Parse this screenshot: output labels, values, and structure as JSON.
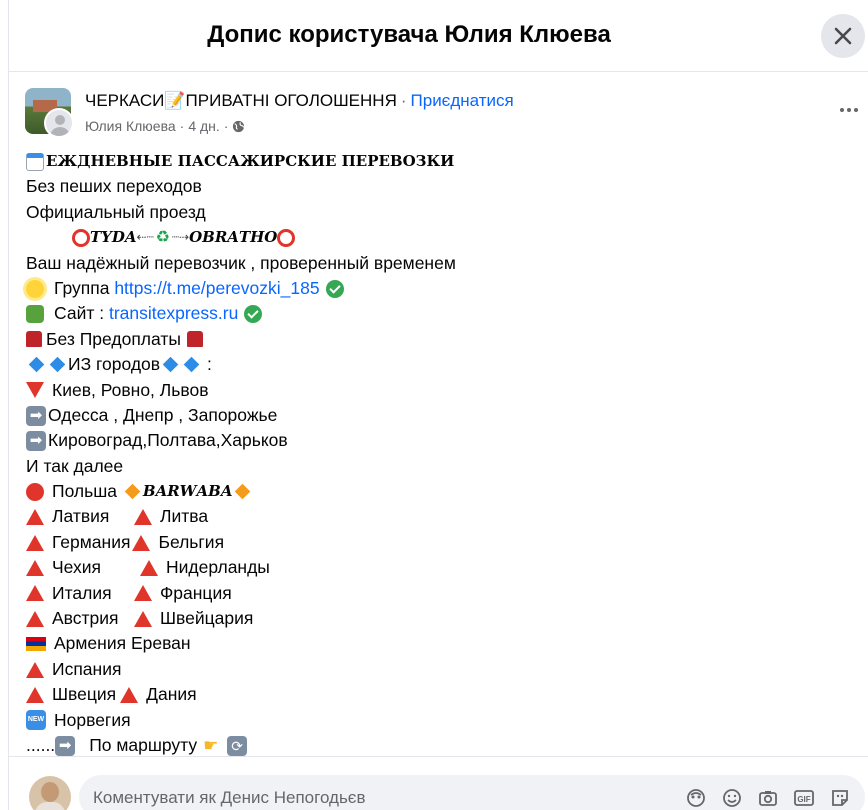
{
  "dialog": {
    "title": "Допис користувача Юлия Клюева"
  },
  "post": {
    "group_name": "ЧЕРКАСИ📝ПРИВАТНІ ОГОЛОШЕННЯ",
    "separator": "·",
    "join_label": "Приєднатися",
    "author": "Юлия Клюева",
    "time": "4 дн.",
    "privacy_icon": "globe-icon"
  },
  "body": {
    "l1": "ЕЖДНЕВНЫЕ ПАССАЖИРСКИЕ ПЕРЕВОЗКИ",
    "l2": "Без пеших переходов",
    "l3": "Официальный проезд",
    "l4a": "𝑻𝒀𝑫𝑨",
    "l4arr1": "⇠┈",
    "l4arr2": "┈⇢",
    "l4b": "𝑶𝑩𝑹𝑨𝑻𝑯𝑶",
    "l5": "Ваш надёжный перевозчик , проверенный временем",
    "l6": "Группа ",
    "l6link": "https://t.me/perevozki_185",
    "l7": "Сайт : ",
    "l7link": "transitexpress.ru",
    "l8": "Без Предоплаты",
    "l9": "ИЗ городов",
    "l9b": " :",
    "l10": "Киев, Ровно, Львов",
    "l11": "Одесса , Днепр , Запорожье",
    "l12": "Кировоград,Полтава,Харьков",
    "l13": "И так далее",
    "l14a": "Польша ",
    "l14b": "𝑩𝑨𝑹𝑾𝑨𝑩𝑨",
    "l15a": "Латвия",
    "l15b": "Литва",
    "l16a": "Германия",
    "l16b": "Бельгия",
    "l17a": "Чехия",
    "l17b": "Нидерланды",
    "l18a": "Италия",
    "l18b": "Франция",
    "l19a": "Австрия",
    "l19b": "Швейцария",
    "l20": "Армения Ереван",
    "l21": "Испания",
    "l22a": "Швеция",
    "l22b": "Дания",
    "l23": "Норвегия",
    "l24a": "......",
    "l24b": "По маршруту",
    "new_badge": "NEW",
    "arrow_glyph": "➡",
    "refresh_glyph": "⟳"
  },
  "footer": {
    "comment_placeholder": "Коментувати як Денис Непогодьєв",
    "icons": [
      "avatar-sticker-icon",
      "emoji-icon",
      "camera-icon",
      "gif-icon",
      "sticker-icon"
    ]
  },
  "colors": {
    "link": "#0866ff",
    "red_emoji": "#e0352b",
    "check": "#34a853"
  }
}
